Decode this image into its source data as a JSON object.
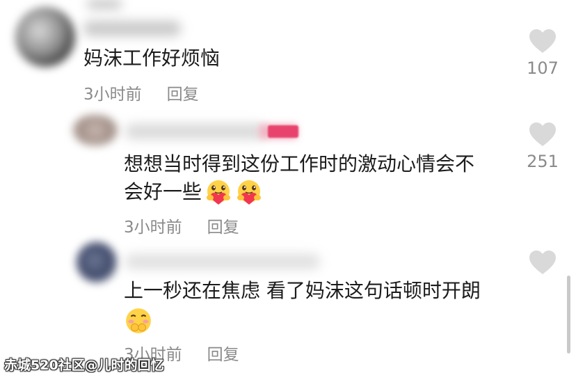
{
  "comments": [
    {
      "text": "妈沫工作好烦恼",
      "time": "3小时前",
      "reply": "回复",
      "likes": "107"
    },
    {
      "text_line1": "想想当时得到这份工作时的激动心情会不",
      "text_line2": "会好一些",
      "time": "3小时前",
      "reply": "回复",
      "likes": "251"
    },
    {
      "text_line1": "上一秒还在焦虑 看了妈沫这句话顿时开朗",
      "time": "3小时前",
      "reply": "回复",
      "likes": ""
    }
  ],
  "watermark": "赤城520社区@儿时的回忆",
  "icons": {
    "like": "heart-icon",
    "emoji_hug": "hugging-heart-emoji",
    "emoji_shy": "shy-blush-emoji"
  },
  "colors": {
    "text": "#1b1b1b",
    "meta": "#8a8a8a",
    "heart": "#d9d9d9"
  }
}
